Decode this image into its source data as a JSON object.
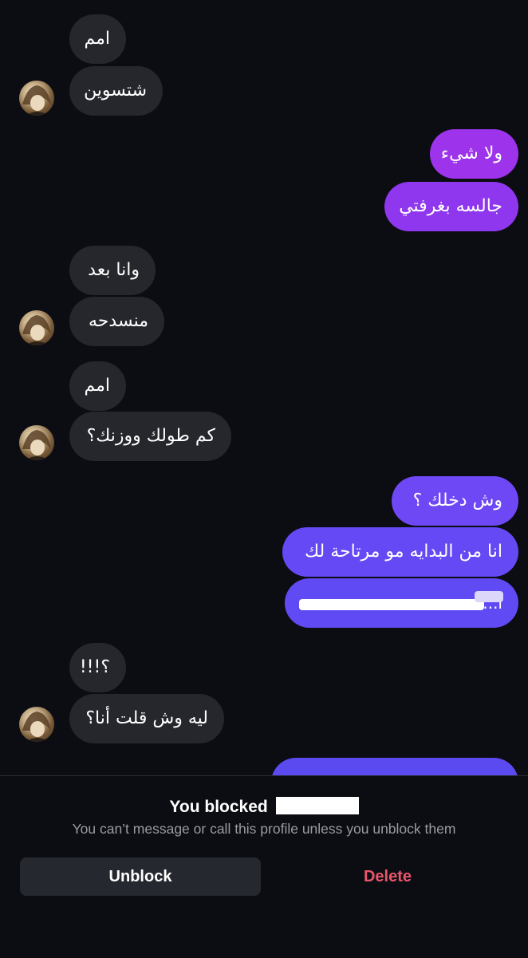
{
  "conversation": {
    "messages": [
      {
        "side": "in",
        "text": "امم"
      },
      {
        "side": "in",
        "text": "شتسوين"
      },
      {
        "side": "out",
        "text": "ولا شيء"
      },
      {
        "side": "out",
        "text": "جالسه بغرفتي"
      },
      {
        "side": "in",
        "text": "وانا بعد"
      },
      {
        "side": "in",
        "text": "منسدحه"
      },
      {
        "side": "in",
        "text": "امم"
      },
      {
        "side": "in",
        "text": "كم طولك ووزنك؟"
      },
      {
        "side": "out",
        "text": "وش دخلك ؟"
      },
      {
        "side": "out",
        "text": "انا من البدايه مو مرتاحة لك"
      },
      {
        "side": "out",
        "text": "ا...ء",
        "redacted": true
      },
      {
        "side": "in",
        "text": "؟!!!"
      },
      {
        "side": "in",
        "text": "ليه وش قلت أنا؟"
      },
      {
        "side": "out",
        "text": "",
        "partial": true
      }
    ],
    "colors": {
      "incoming_bubble": "#26272d",
      "outgoing_gradient": [
        "#a032e8",
        "#6a4bf6",
        "#5a48ee"
      ]
    },
    "contact_avatar_icon": "contact-avatar"
  },
  "blocked_banner": {
    "title": "You blocked",
    "subtitle": "You can’t message or call this profile unless you unblock them",
    "unblock_label": "Unblock",
    "delete_label": "Delete",
    "delete_color": "#e8566b"
  }
}
